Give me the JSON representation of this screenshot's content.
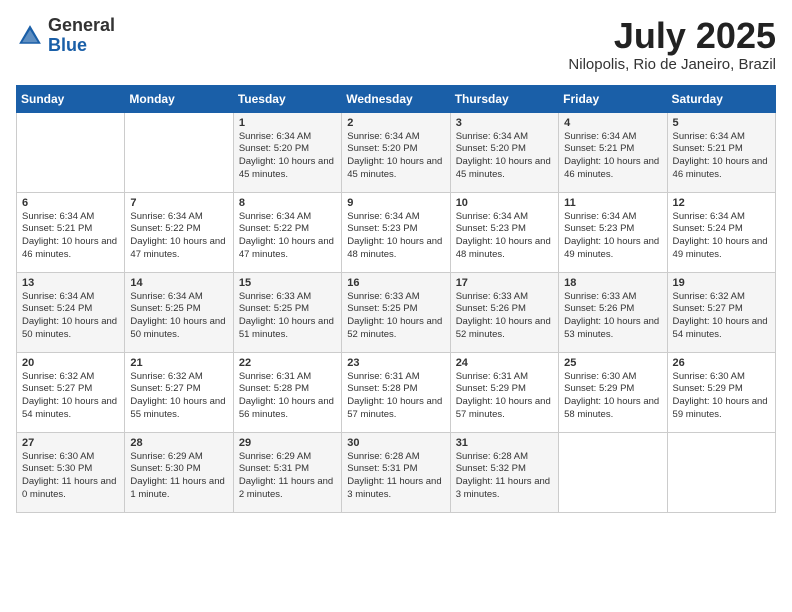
{
  "header": {
    "logo_general": "General",
    "logo_blue": "Blue",
    "month_year": "July 2025",
    "location": "Nilopolis, Rio de Janeiro, Brazil"
  },
  "weekdays": [
    "Sunday",
    "Monday",
    "Tuesday",
    "Wednesday",
    "Thursday",
    "Friday",
    "Saturday"
  ],
  "weeks": [
    [
      {
        "day": "",
        "detail": ""
      },
      {
        "day": "",
        "detail": ""
      },
      {
        "day": "1",
        "detail": "Sunrise: 6:34 AM\nSunset: 5:20 PM\nDaylight: 10 hours and 45 minutes."
      },
      {
        "day": "2",
        "detail": "Sunrise: 6:34 AM\nSunset: 5:20 PM\nDaylight: 10 hours and 45 minutes."
      },
      {
        "day": "3",
        "detail": "Sunrise: 6:34 AM\nSunset: 5:20 PM\nDaylight: 10 hours and 45 minutes."
      },
      {
        "day": "4",
        "detail": "Sunrise: 6:34 AM\nSunset: 5:21 PM\nDaylight: 10 hours and 46 minutes."
      },
      {
        "day": "5",
        "detail": "Sunrise: 6:34 AM\nSunset: 5:21 PM\nDaylight: 10 hours and 46 minutes."
      }
    ],
    [
      {
        "day": "6",
        "detail": "Sunrise: 6:34 AM\nSunset: 5:21 PM\nDaylight: 10 hours and 46 minutes."
      },
      {
        "day": "7",
        "detail": "Sunrise: 6:34 AM\nSunset: 5:22 PM\nDaylight: 10 hours and 47 minutes."
      },
      {
        "day": "8",
        "detail": "Sunrise: 6:34 AM\nSunset: 5:22 PM\nDaylight: 10 hours and 47 minutes."
      },
      {
        "day": "9",
        "detail": "Sunrise: 6:34 AM\nSunset: 5:23 PM\nDaylight: 10 hours and 48 minutes."
      },
      {
        "day": "10",
        "detail": "Sunrise: 6:34 AM\nSunset: 5:23 PM\nDaylight: 10 hours and 48 minutes."
      },
      {
        "day": "11",
        "detail": "Sunrise: 6:34 AM\nSunset: 5:23 PM\nDaylight: 10 hours and 49 minutes."
      },
      {
        "day": "12",
        "detail": "Sunrise: 6:34 AM\nSunset: 5:24 PM\nDaylight: 10 hours and 49 minutes."
      }
    ],
    [
      {
        "day": "13",
        "detail": "Sunrise: 6:34 AM\nSunset: 5:24 PM\nDaylight: 10 hours and 50 minutes."
      },
      {
        "day": "14",
        "detail": "Sunrise: 6:34 AM\nSunset: 5:25 PM\nDaylight: 10 hours and 50 minutes."
      },
      {
        "day": "15",
        "detail": "Sunrise: 6:33 AM\nSunset: 5:25 PM\nDaylight: 10 hours and 51 minutes."
      },
      {
        "day": "16",
        "detail": "Sunrise: 6:33 AM\nSunset: 5:25 PM\nDaylight: 10 hours and 52 minutes."
      },
      {
        "day": "17",
        "detail": "Sunrise: 6:33 AM\nSunset: 5:26 PM\nDaylight: 10 hours and 52 minutes."
      },
      {
        "day": "18",
        "detail": "Sunrise: 6:33 AM\nSunset: 5:26 PM\nDaylight: 10 hours and 53 minutes."
      },
      {
        "day": "19",
        "detail": "Sunrise: 6:32 AM\nSunset: 5:27 PM\nDaylight: 10 hours and 54 minutes."
      }
    ],
    [
      {
        "day": "20",
        "detail": "Sunrise: 6:32 AM\nSunset: 5:27 PM\nDaylight: 10 hours and 54 minutes."
      },
      {
        "day": "21",
        "detail": "Sunrise: 6:32 AM\nSunset: 5:27 PM\nDaylight: 10 hours and 55 minutes."
      },
      {
        "day": "22",
        "detail": "Sunrise: 6:31 AM\nSunset: 5:28 PM\nDaylight: 10 hours and 56 minutes."
      },
      {
        "day": "23",
        "detail": "Sunrise: 6:31 AM\nSunset: 5:28 PM\nDaylight: 10 hours and 57 minutes."
      },
      {
        "day": "24",
        "detail": "Sunrise: 6:31 AM\nSunset: 5:29 PM\nDaylight: 10 hours and 57 minutes."
      },
      {
        "day": "25",
        "detail": "Sunrise: 6:30 AM\nSunset: 5:29 PM\nDaylight: 10 hours and 58 minutes."
      },
      {
        "day": "26",
        "detail": "Sunrise: 6:30 AM\nSunset: 5:29 PM\nDaylight: 10 hours and 59 minutes."
      }
    ],
    [
      {
        "day": "27",
        "detail": "Sunrise: 6:30 AM\nSunset: 5:30 PM\nDaylight: 11 hours and 0 minutes."
      },
      {
        "day": "28",
        "detail": "Sunrise: 6:29 AM\nSunset: 5:30 PM\nDaylight: 11 hours and 1 minute."
      },
      {
        "day": "29",
        "detail": "Sunrise: 6:29 AM\nSunset: 5:31 PM\nDaylight: 11 hours and 2 minutes."
      },
      {
        "day": "30",
        "detail": "Sunrise: 6:28 AM\nSunset: 5:31 PM\nDaylight: 11 hours and 3 minutes."
      },
      {
        "day": "31",
        "detail": "Sunrise: 6:28 AM\nSunset: 5:32 PM\nDaylight: 11 hours and 3 minutes."
      },
      {
        "day": "",
        "detail": ""
      },
      {
        "day": "",
        "detail": ""
      }
    ]
  ]
}
